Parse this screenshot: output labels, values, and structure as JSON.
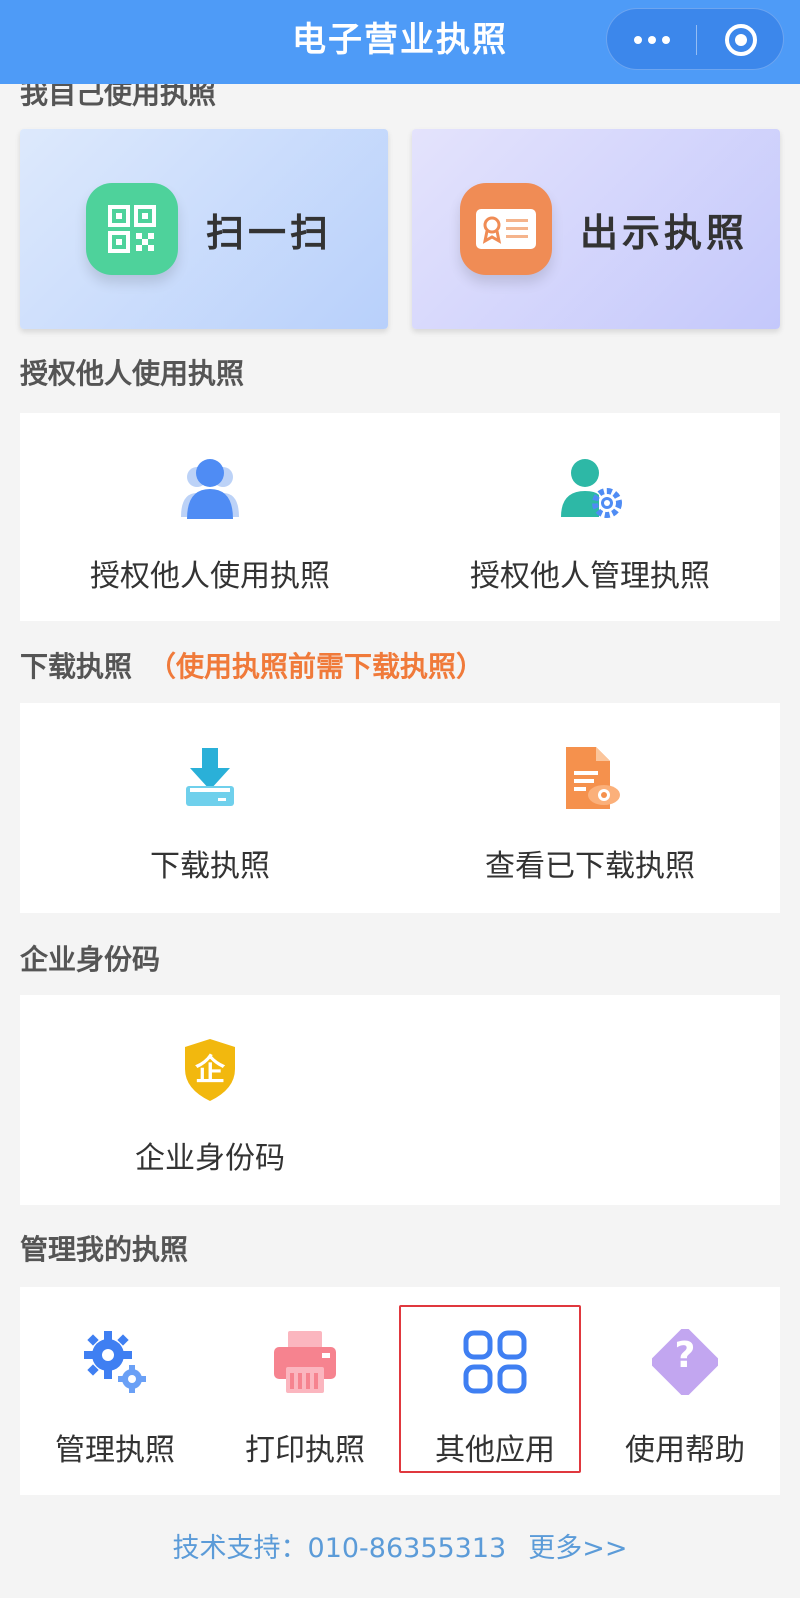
{
  "header": {
    "title": "电子营业执照"
  },
  "sections": {
    "self_use": "我自己使用执照",
    "authorize": "授权他人使用执照",
    "download": "下载执照",
    "download_note": "（使用执照前需下载执照）",
    "enterprise_code": "企业身份码",
    "manage": "管理我的执照"
  },
  "top_cards": {
    "scan": "扫一扫",
    "show": "出示执照"
  },
  "authorize_items": [
    {
      "label": "授权他人使用执照",
      "icon": "user-icon"
    },
    {
      "label": "授权他人管理执照",
      "icon": "user-gear-icon"
    }
  ],
  "download_items": [
    {
      "label": "下载执照",
      "icon": "download-icon"
    },
    {
      "label": "查看已下载执照",
      "icon": "document-view-icon"
    }
  ],
  "enterprise_items": [
    {
      "label": "企业身份码",
      "icon": "shield-qi-icon",
      "icon_text": "企"
    }
  ],
  "manage_items": [
    {
      "label": "管理执照",
      "icon": "gears-icon"
    },
    {
      "label": "打印执照",
      "icon": "printer-icon"
    },
    {
      "label": "其他应用",
      "icon": "grid-apps-icon"
    },
    {
      "label": "使用帮助",
      "icon": "help-icon",
      "icon_text": "?"
    }
  ],
  "footer": {
    "support": "技术支持：010-86355313",
    "more": "更多>>"
  },
  "colors": {
    "header": "#4e9bf7",
    "accent_note": "#f07a3a",
    "footer_link": "#5b9bd8",
    "highlight": "#e0383e"
  }
}
